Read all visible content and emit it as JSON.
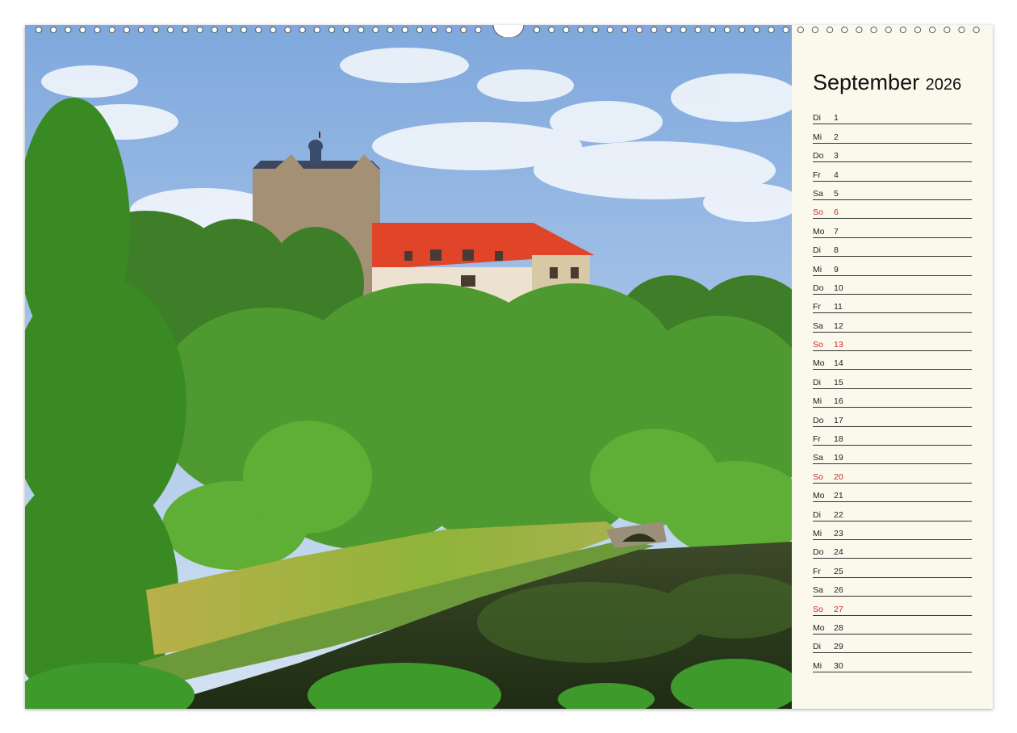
{
  "calendar": {
    "month": "September",
    "year": "2026",
    "days": [
      {
        "wd": "Di",
        "d": "1",
        "sunday": false
      },
      {
        "wd": "Mi",
        "d": "2",
        "sunday": false
      },
      {
        "wd": "Do",
        "d": "3",
        "sunday": false
      },
      {
        "wd": "Fr",
        "d": "4",
        "sunday": false
      },
      {
        "wd": "Sa",
        "d": "5",
        "sunday": false
      },
      {
        "wd": "So",
        "d": "6",
        "sunday": true
      },
      {
        "wd": "Mo",
        "d": "7",
        "sunday": false
      },
      {
        "wd": "Di",
        "d": "8",
        "sunday": false
      },
      {
        "wd": "Mi",
        "d": "9",
        "sunday": false
      },
      {
        "wd": "Do",
        "d": "10",
        "sunday": false
      },
      {
        "wd": "Fr",
        "d": "11",
        "sunday": false
      },
      {
        "wd": "Sa",
        "d": "12",
        "sunday": false
      },
      {
        "wd": "So",
        "d": "13",
        "sunday": true
      },
      {
        "wd": "Mo",
        "d": "14",
        "sunday": false
      },
      {
        "wd": "Di",
        "d": "15",
        "sunday": false
      },
      {
        "wd": "Mi",
        "d": "16",
        "sunday": false
      },
      {
        "wd": "Do",
        "d": "17",
        "sunday": false
      },
      {
        "wd": "Fr",
        "d": "18",
        "sunday": false
      },
      {
        "wd": "Sa",
        "d": "19",
        "sunday": false
      },
      {
        "wd": "So",
        "d": "20",
        "sunday": true
      },
      {
        "wd": "Mo",
        "d": "21",
        "sunday": false
      },
      {
        "wd": "Di",
        "d": "22",
        "sunday": false
      },
      {
        "wd": "Mi",
        "d": "23",
        "sunday": false
      },
      {
        "wd": "Do",
        "d": "24",
        "sunday": false
      },
      {
        "wd": "Fr",
        "d": "25",
        "sunday": false
      },
      {
        "wd": "Sa",
        "d": "26",
        "sunday": false
      },
      {
        "wd": "So",
        "d": "27",
        "sunday": true
      },
      {
        "wd": "Mo",
        "d": "28",
        "sunday": false
      },
      {
        "wd": "Di",
        "d": "29",
        "sunday": false
      },
      {
        "wd": "Mi",
        "d": "30",
        "sunday": false
      }
    ]
  },
  "colors": {
    "sunday": "#cc2a2a",
    "paper": "#fbf8ec",
    "sky": "#8fb4e0",
    "foliage": "#3f8a2a",
    "roof": "#e0452a"
  },
  "photo": {
    "subject_icon": "castle-landscape-photo"
  }
}
